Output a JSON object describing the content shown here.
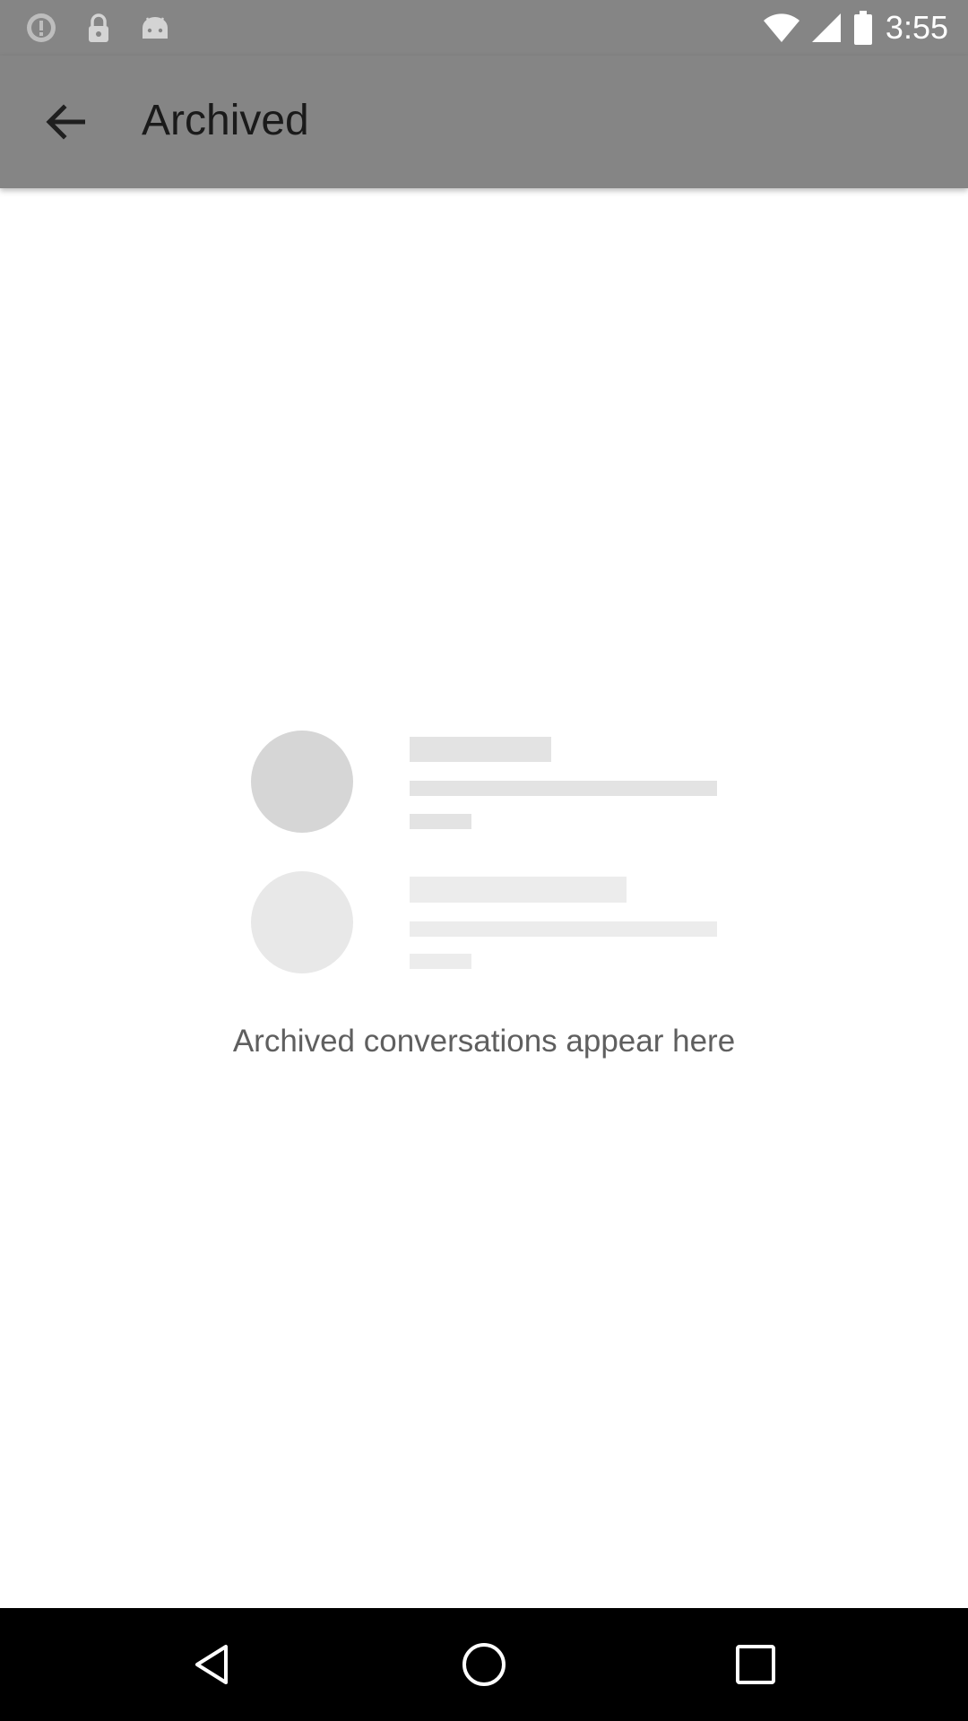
{
  "status_bar": {
    "time": "3:55",
    "icons": [
      "alert-icon",
      "lock-icon",
      "android-icon",
      "wifi-icon",
      "signal-icon",
      "battery-icon"
    ]
  },
  "app_bar": {
    "title": "Archived",
    "back_icon": "arrow-back-icon"
  },
  "empty_state": {
    "message": "Archived conversations appear here",
    "illustration": "placeholder-conversation-list"
  },
  "nav_bar": {
    "buttons": [
      "back-triangle-icon",
      "home-circle-icon",
      "recents-square-icon"
    ]
  },
  "colors": {
    "app_bar": "#858585",
    "status_bar": "#858585",
    "placeholder_circle_1": "#d6d6d6",
    "placeholder_circle_2": "#e6e6e6",
    "placeholder_bar": "#e4e4e4",
    "nav_bar": "#000000"
  }
}
